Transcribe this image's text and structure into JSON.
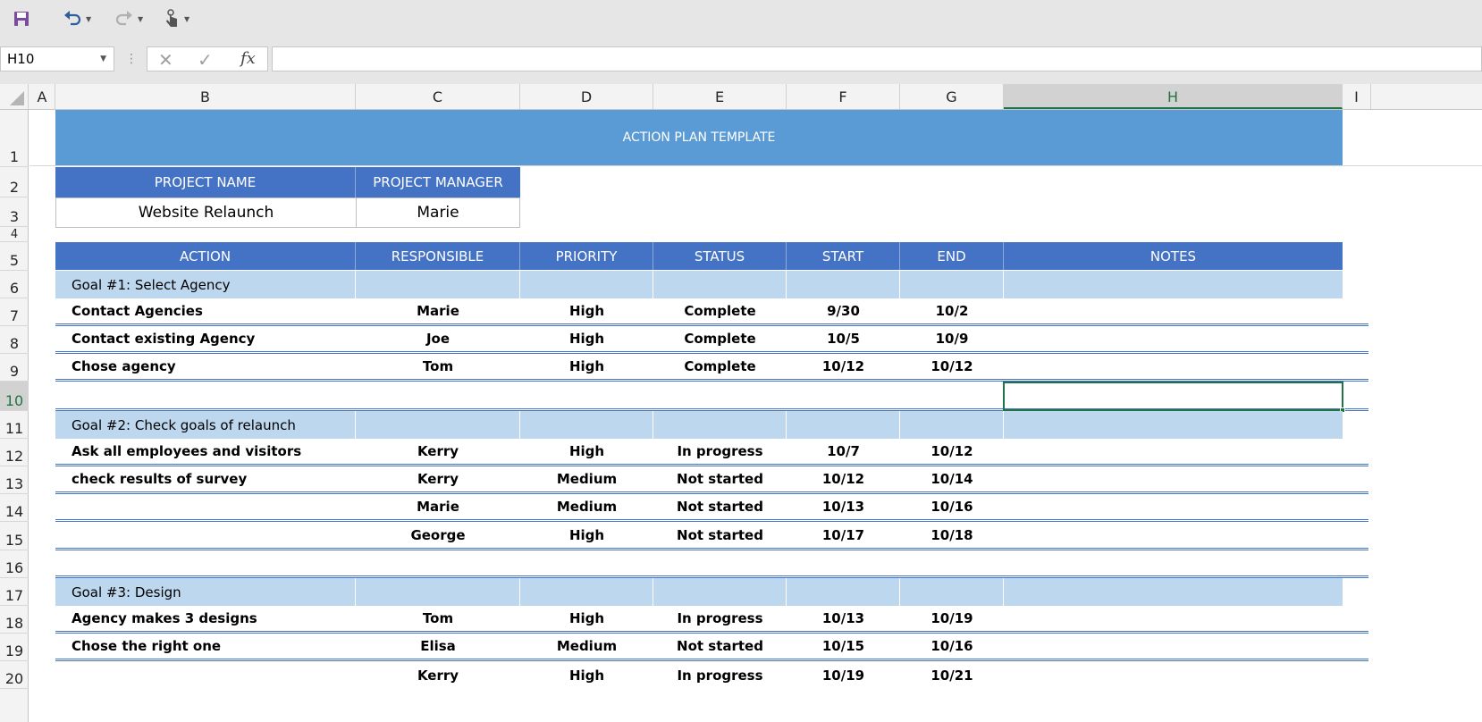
{
  "toolbar": {
    "save_icon": "save-icon",
    "undo_icon": "undo-icon",
    "redo_icon": "redo-icon",
    "touch_icon": "touch-mode-icon"
  },
  "formula_bar": {
    "name_box": "H10",
    "fx": "fx",
    "value": ""
  },
  "columns": [
    "A",
    "B",
    "C",
    "D",
    "E",
    "F",
    "G",
    "H",
    "I"
  ],
  "selected_column": "H",
  "rows": [
    "1",
    "2",
    "3",
    "4",
    "5",
    "6",
    "7",
    "8",
    "9",
    "10",
    "11",
    "12",
    "13",
    "14",
    "15",
    "16",
    "17",
    "18",
    "19",
    "20"
  ],
  "selected_row": "10",
  "sheet": {
    "banner": "ACTION PLAN TEMPLATE",
    "project_name_label": "PROJECT NAME",
    "project_manager_label": "PROJECT MANAGER",
    "project_name": "Website Relaunch",
    "project_manager": "Marie",
    "headers": [
      "ACTION",
      "RESPONSIBLE",
      "PRIORITY",
      "STATUS",
      "START",
      "END",
      "NOTES"
    ],
    "goal1": "Goal #1:  Select Agency",
    "goal2": "Goal #2: Check goals of relaunch",
    "goal3": "Goal #3: Design",
    "tasks": [
      {
        "action": "Contact Agencies",
        "responsible": "Marie",
        "priority": "High",
        "status": "Complete",
        "start": "9/30",
        "end": "10/2"
      },
      {
        "action": "Contact existing Agency",
        "responsible": "Joe",
        "priority": "High",
        "status": "Complete",
        "start": "10/5",
        "end": "10/9"
      },
      {
        "action": "Chose agency",
        "responsible": "Tom",
        "priority": "High",
        "status": "Complete",
        "start": "10/12",
        "end": "10/12"
      },
      {
        "action": "Ask all employees and visitors",
        "responsible": "Kerry",
        "priority": "High",
        "status": "In progress",
        "start": "10/7",
        "end": "10/12"
      },
      {
        "action": "check results of survey",
        "responsible": "Kerry",
        "priority": "Medium",
        "status": "Not started",
        "start": "10/12",
        "end": "10/14"
      },
      {
        "action": "",
        "responsible": "Marie",
        "priority": "Medium",
        "status": "Not started",
        "start": "10/13",
        "end": "10/16"
      },
      {
        "action": "",
        "responsible": "George",
        "priority": "High",
        "status": "Not started",
        "start": "10/17",
        "end": "10/18"
      },
      {
        "action": "Agency makes 3 designs",
        "responsible": "Tom",
        "priority": "High",
        "status": "In progress",
        "start": "10/13",
        "end": "10/19"
      },
      {
        "action": "Chose the right one",
        "responsible": "Elisa",
        "priority": "Medium",
        "status": "Not started",
        "start": "10/15",
        "end": "10/16"
      },
      {
        "action": "",
        "responsible": "Kerry",
        "priority": "High",
        "status": "In progress",
        "start": "10/19",
        "end": "10/21"
      }
    ]
  }
}
